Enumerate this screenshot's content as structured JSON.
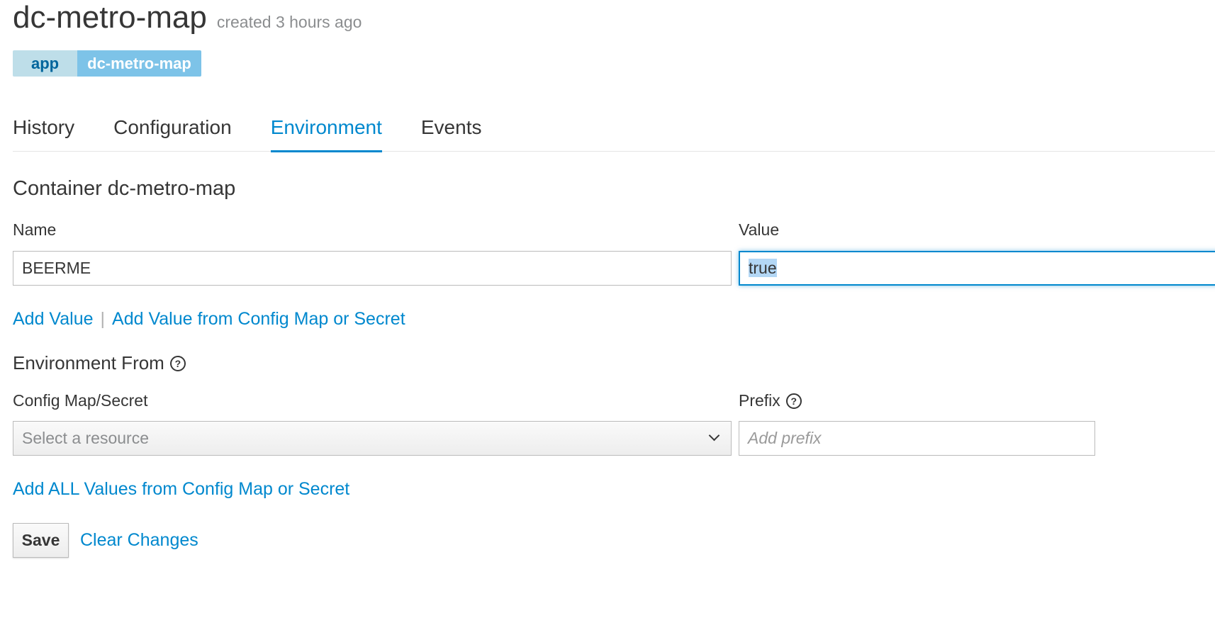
{
  "header": {
    "title": "dc-metro-map",
    "created": "created 3 hours ago"
  },
  "label": {
    "key": "app",
    "value": "dc-metro-map"
  },
  "tabs": [
    {
      "label": "History",
      "active": false
    },
    {
      "label": "Configuration",
      "active": false
    },
    {
      "label": "Environment",
      "active": true
    },
    {
      "label": "Events",
      "active": false
    }
  ],
  "container": {
    "title": "Container dc-metro-map",
    "name_label": "Name",
    "value_label": "Value",
    "name_value": "BEERME",
    "value_value": "true"
  },
  "actions": {
    "add_value": "Add Value",
    "separator": "|",
    "add_from_config": "Add Value from Config Map or Secret"
  },
  "env_from": {
    "title": "Environment From",
    "config_label": "Config Map/Secret",
    "prefix_label": "Prefix",
    "select_placeholder": "Select a resource",
    "prefix_placeholder": "Add prefix",
    "add_all": "Add ALL Values from Config Map or Secret"
  },
  "footer": {
    "save": "Save",
    "clear": "Clear Changes"
  },
  "colors": {
    "link": "#0088ce",
    "label_key_bg": "#bedee9",
    "label_value_bg": "#7dc3e8"
  }
}
